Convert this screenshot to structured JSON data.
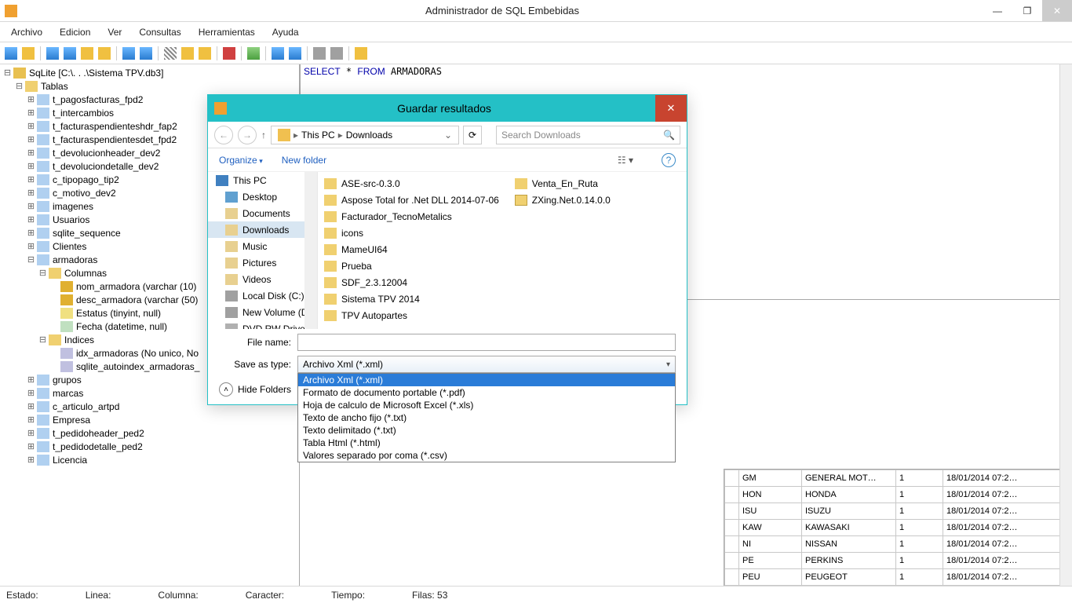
{
  "window": {
    "title": "Administrador de SQL Embebidas"
  },
  "menu": [
    "Archivo",
    "Edicion",
    "Ver",
    "Consultas",
    "Herramientas",
    "Ayuda"
  ],
  "tree": {
    "root": "SqLite [C:\\. . .\\Sistema TPV.db3]",
    "tables_label": "Tablas",
    "tables": [
      "t_pagosfacturas_fpd2",
      "t_intercambios",
      "t_facturaspendienteshdr_fap2",
      "t_facturaspendientesdet_fpd2",
      "t_devolucionheader_dev2",
      "t_devoluciondetalle_dev2",
      "c_tipopago_tip2",
      "c_motivo_dev2",
      "imagenes",
      "Usuarios",
      "sqlite_sequence",
      "Clientes"
    ],
    "arm": "armadoras",
    "cols_label": "Columnas",
    "cols": [
      "nom_armadora (varchar (10)",
      "desc_armadora (varchar (50)",
      "Estatus (tinyint, null)",
      "Fecha (datetime, null)"
    ],
    "idx_label": "Indices",
    "idx": [
      "idx_armadoras (No unico, No",
      "sqlite_autoindex_armadoras_"
    ],
    "rest": [
      "grupos",
      "marcas",
      "c_articulo_artpd",
      "Empresa",
      "t_pedidoheader_ped2",
      "t_pedidodetalle_ped2",
      "Licencia"
    ]
  },
  "sql": "SELECT * FROM ARMADORAS",
  "grid": [
    [
      "GM",
      "GENERAL MOT…",
      "1",
      "18/01/2014 07:2…"
    ],
    [
      "HON",
      "HONDA",
      "1",
      "18/01/2014 07:2…"
    ],
    [
      "ISU",
      "ISUZU",
      "1",
      "18/01/2014 07:2…"
    ],
    [
      "KAW",
      "KAWASAKI",
      "1",
      "18/01/2014 07:2…"
    ],
    [
      "NI",
      "NISSAN",
      "1",
      "18/01/2014 07:2…"
    ],
    [
      "PE",
      "PERKINS",
      "1",
      "18/01/2014 07:2…"
    ],
    [
      "PEU",
      "PEUGEOT",
      "1",
      "18/01/2014 07:2…"
    ]
  ],
  "status": {
    "estado": "Estado:",
    "linea": "Linea:",
    "columna": "Columna:",
    "caracter": "Caracter:",
    "tiempo": "Tiempo:",
    "filas": "Filas: 53"
  },
  "dialog": {
    "title": "Guardar resultados",
    "bc1": "This PC",
    "bc2": "Downloads",
    "search_ph": "Search Downloads",
    "organize": "Organize",
    "newfolder": "New folder",
    "nav": [
      "This PC",
      "Desktop",
      "Documents",
      "Downloads",
      "Music",
      "Pictures",
      "Videos",
      "Local Disk (C:)",
      "New Volume (D",
      "DVD RW Drive ("
    ],
    "files1": [
      "ASE-src-0.3.0",
      "Aspose Total for .Net DLL 2014-07-06",
      "Facturador_TecnoMetalics",
      "icons",
      "MameUI64",
      "Prueba",
      "SDF_2.3.12004",
      "Sistema TPV 2014",
      "TPV Autopartes"
    ],
    "files2": [
      "Venta_En_Ruta",
      "ZXing.Net.0.14.0.0"
    ],
    "fname_lbl": "File name:",
    "stype_lbl": "Save as type:",
    "stype_sel": "Archivo Xml (*.xml)",
    "options": [
      "Archivo Xml (*.xml)",
      "Formato de documento portable (*.pdf)",
      "Hoja de calculo de Microsoft Excel (*.xls)",
      "Texto de ancho fijo (*.txt)",
      "Texto delimitado (*.txt)",
      "Tabla Html (*.html)",
      "Valores separado por coma (*.csv)"
    ],
    "hide": "Hide Folders"
  }
}
